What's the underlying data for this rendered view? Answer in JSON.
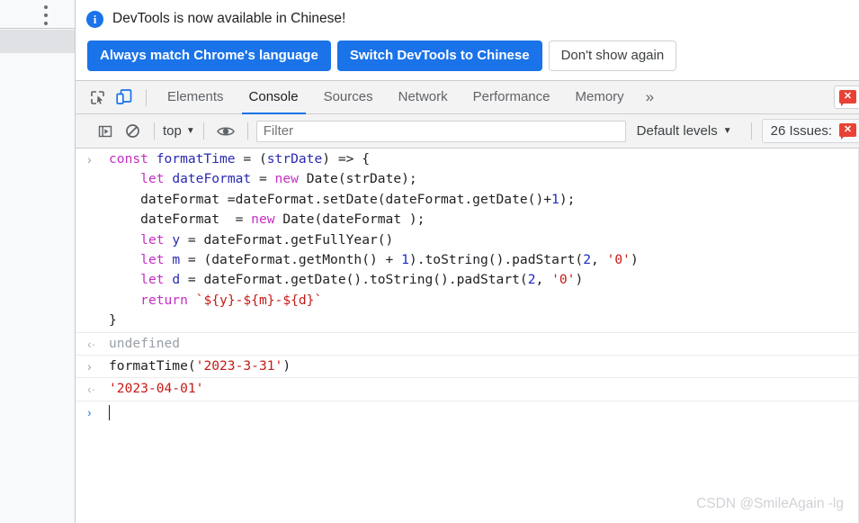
{
  "page_sidebar": {
    "menu_icon": "kebab-menu-icon",
    "selected_row_label": ""
  },
  "banner": {
    "icon": "info-icon",
    "message": "DevTools is now available in Chinese!",
    "buttons": [
      {
        "label": "Always match Chrome's language",
        "style": "primary"
      },
      {
        "label": "Switch DevTools to Chinese",
        "style": "primary"
      },
      {
        "label": "Don't show again",
        "style": "secondary"
      }
    ]
  },
  "tabbar": {
    "icons": [
      {
        "name": "inspect-element-icon",
        "active": false
      },
      {
        "name": "device-toolbar-icon",
        "active": true
      }
    ],
    "tabs": [
      {
        "label": "Elements",
        "active": false
      },
      {
        "label": "Console",
        "active": true
      },
      {
        "label": "Sources",
        "active": false
      },
      {
        "label": "Network",
        "active": false
      },
      {
        "label": "Performance",
        "active": false
      },
      {
        "label": "Memory",
        "active": false
      }
    ],
    "more_label": "»",
    "error_badge_icon": "error-bubble-icon"
  },
  "console_toolbar": {
    "sidebar_toggle_icon": "console-sidebar-icon",
    "clear_icon": "clear-console-icon",
    "context_label": "top",
    "eye_icon": "live-expression-eye-icon",
    "filter_placeholder": "Filter",
    "filter_value": "",
    "levels_label": "Default levels",
    "issues_label": "26 Issues:",
    "issues_badge_icon": "error-bubble-icon"
  },
  "console": {
    "messages": [
      {
        "type": "input",
        "gutter": "›",
        "lines": [
          [
            {
              "t": "const ",
              "c": "kw"
            },
            {
              "t": "formatTime",
              "c": "fn"
            },
            {
              "t": " = (",
              "c": "plain"
            },
            {
              "t": "strDate",
              "c": "fn"
            },
            {
              "t": ") => {",
              "c": "plain"
            }
          ],
          [
            {
              "t": "    ",
              "c": "plain"
            },
            {
              "t": "let ",
              "c": "kw"
            },
            {
              "t": "dateFormat",
              "c": "fn"
            },
            {
              "t": " = ",
              "c": "plain"
            },
            {
              "t": "new ",
              "c": "kw"
            },
            {
              "t": "Date(strDate);",
              "c": "plain"
            }
          ],
          [
            {
              "t": "    dateFormat =dateFormat.setDate(dateFormat.getDate()+",
              "c": "plain"
            },
            {
              "t": "1",
              "c": "num"
            },
            {
              "t": ");",
              "c": "plain"
            }
          ],
          [
            {
              "t": "    dateFormat  = ",
              "c": "plain"
            },
            {
              "t": "new ",
              "c": "kw"
            },
            {
              "t": "Date(dateFormat );",
              "c": "plain"
            }
          ],
          [
            {
              "t": "    ",
              "c": "plain"
            },
            {
              "t": "let ",
              "c": "kw"
            },
            {
              "t": "y",
              "c": "fn"
            },
            {
              "t": " = dateFormat.getFullYear()",
              "c": "plain"
            }
          ],
          [
            {
              "t": "    ",
              "c": "plain"
            },
            {
              "t": "let ",
              "c": "kw"
            },
            {
              "t": "m",
              "c": "fn"
            },
            {
              "t": " = (dateFormat.getMonth() + ",
              "c": "plain"
            },
            {
              "t": "1",
              "c": "num"
            },
            {
              "t": ").toString().padStart(",
              "c": "plain"
            },
            {
              "t": "2",
              "c": "num"
            },
            {
              "t": ", ",
              "c": "plain"
            },
            {
              "t": "'0'",
              "c": "str"
            },
            {
              "t": ")",
              "c": "plain"
            }
          ],
          [
            {
              "t": "    ",
              "c": "plain"
            },
            {
              "t": "let ",
              "c": "kw"
            },
            {
              "t": "d",
              "c": "fn"
            },
            {
              "t": " = dateFormat.getDate().toString().padStart(",
              "c": "plain"
            },
            {
              "t": "2",
              "c": "num"
            },
            {
              "t": ", ",
              "c": "plain"
            },
            {
              "t": "'0'",
              "c": "str"
            },
            {
              "t": ")",
              "c": "plain"
            }
          ],
          [
            {
              "t": "    ",
              "c": "plain"
            },
            {
              "t": "return ",
              "c": "kw"
            },
            {
              "t": "`${y}-${m}-${d}`",
              "c": "str"
            }
          ],
          [
            {
              "t": "}",
              "c": "plain"
            }
          ]
        ]
      },
      {
        "type": "output",
        "gutter": "‹·",
        "lines": [
          [
            {
              "t": "undefined",
              "c": "result-undef"
            }
          ]
        ]
      },
      {
        "type": "input",
        "gutter": "›",
        "lines": [
          [
            {
              "t": "formatTime(",
              "c": "plain"
            },
            {
              "t": "'2023-3-31'",
              "c": "str"
            },
            {
              "t": ")",
              "c": "plain"
            }
          ]
        ]
      },
      {
        "type": "output",
        "gutter": "‹·",
        "lines": [
          [
            {
              "t": "'2023-04-01'",
              "c": "result-str"
            }
          ]
        ]
      }
    ],
    "prompt_gutter": "›",
    "prompt_value": ""
  },
  "watermark": {
    "text": "CSDN @SmileAgain -lg"
  },
  "colors": {
    "accent_blue": "#1a73e8",
    "error_red": "#e94235",
    "keyword_purple": "#c42fc4",
    "string_red": "#c41a16",
    "number_blue": "#1c28c8",
    "muted_gray": "#9aa0a6"
  }
}
